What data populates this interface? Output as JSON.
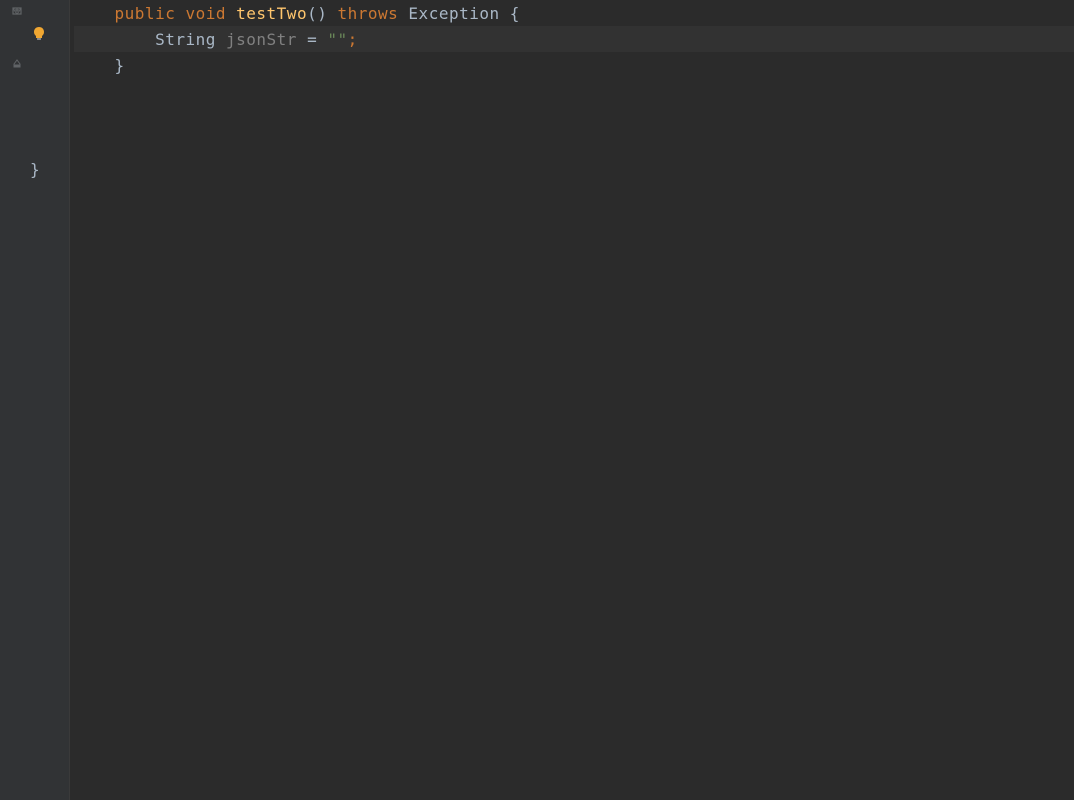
{
  "code": {
    "line1": {
      "indent": "    ",
      "public": "public",
      "void": "void",
      "method": "testTwo",
      "parens": "()",
      "throws": "throws",
      "exception": "Exception",
      "open_brace": "{"
    },
    "line2": {
      "indent": "        ",
      "type": "String",
      "var": "jsonStr",
      "equals": "=",
      "string": "\"\"",
      "semi": ";"
    },
    "line3": {
      "indent": "    ",
      "close_brace": "}"
    },
    "line4": {
      "class_close": "}"
    }
  },
  "icons": {
    "fold_open": "fold-open-icon",
    "fold_close": "fold-close-icon",
    "bulb": "lightbulb-icon"
  }
}
